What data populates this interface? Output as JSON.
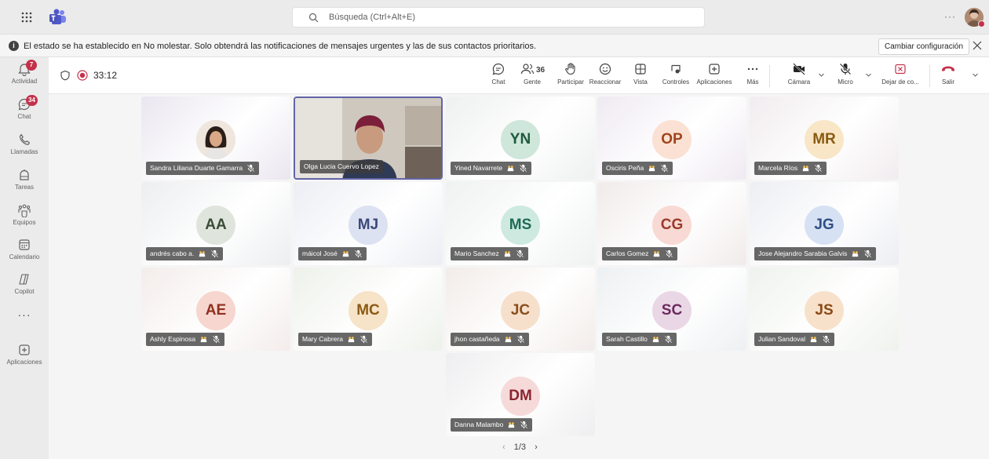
{
  "app": {
    "search_placeholder": "Búsqueda (Ctrl+Alt+E)",
    "more_label": "···"
  },
  "banner": {
    "info_glyph": "i",
    "text": "El estado se ha establecido en No molestar. Solo obtendrá las notificaciones de mensajes urgentes y las de sus contactos prioritarios.",
    "button": "Cambiar configuración"
  },
  "rail": {
    "items": [
      {
        "label": "Actividad",
        "badge": "7",
        "icon": "bell-icon"
      },
      {
        "label": "Chat",
        "badge": "34",
        "icon": "chat-icon"
      },
      {
        "label": "Llamadas",
        "icon": "phone-icon"
      },
      {
        "label": "Tareas",
        "icon": "tasks-icon"
      },
      {
        "label": "Equipos",
        "icon": "teams-icon"
      },
      {
        "label": "Calendario",
        "icon": "calendar-icon"
      },
      {
        "label": "Copilot",
        "icon": "copilot-icon"
      },
      {
        "label": "···",
        "icon": "more-icon"
      },
      {
        "label": "Aplicaciones",
        "icon": "apps-icon"
      }
    ]
  },
  "meeting": {
    "timer": "33:12",
    "people_count": "36",
    "toolbar": [
      {
        "label": "Chat",
        "icon": "chat-icon"
      },
      {
        "label": "Gente",
        "icon": "people-icon"
      },
      {
        "label": "Participar",
        "icon": "raise-hand-icon"
      },
      {
        "label": "Reaccionar",
        "icon": "emoji-icon"
      },
      {
        "label": "Vista",
        "icon": "view-grid-icon"
      },
      {
        "label": "Controles",
        "icon": "controls-icon"
      },
      {
        "label": "Aplicaciones",
        "icon": "apps-add-icon"
      },
      {
        "label": "Más",
        "icon": "more-icon"
      },
      {
        "label": "Cámara",
        "icon": "camera-off-icon"
      },
      {
        "label": "Micro",
        "icon": "mic-off-icon"
      },
      {
        "label": "Dejar de co...",
        "icon": "stop-share-icon"
      },
      {
        "label": "Salir",
        "icon": "hang-up-icon"
      }
    ]
  },
  "participants": [
    {
      "name": "Sandra Liliana Duarte Gamarra",
      "initials": "",
      "photo": true,
      "hand": false,
      "colors": {
        "bg": "#eae6f0",
        "av": "#d9cfc6",
        "fg": "#5a4a3a"
      }
    },
    {
      "name": "Olga Lucia Cuervo Lopez",
      "initials": "",
      "video": true,
      "hand": false,
      "colors": {
        "bg": "#c9c1b8",
        "av": "#d9cfc6",
        "fg": "#5a4a3a"
      }
    },
    {
      "name": "Yined Navarrete",
      "initials": "YN",
      "hand": true,
      "colors": {
        "bg": "#eef1ef",
        "av": "#cfe6da",
        "fg": "#1e5a3b"
      }
    },
    {
      "name": "Osciris Peña",
      "initials": "OP",
      "hand": true,
      "colors": {
        "bg": "#efeaf2",
        "av": "#fbe1d3",
        "fg": "#a0451a"
      }
    },
    {
      "name": "Marcela Ríos",
      "initials": "MR",
      "hand": true,
      "colors": {
        "bg": "#f1ecef",
        "av": "#f8e6c6",
        "fg": "#8a5a10"
      }
    },
    {
      "name": "andrés cabo a.",
      "initials": "AA",
      "hand": true,
      "colors": {
        "bg": "#eceef0",
        "av": "#dfe5dc",
        "fg": "#3a4a36"
      }
    },
    {
      "name": "máicol José",
      "initials": "MJ",
      "hand": true,
      "colors": {
        "bg": "#eceef4",
        "av": "#dde2f2",
        "fg": "#3b4a7a"
      }
    },
    {
      "name": "Mario Sanchez",
      "initials": "MS",
      "hand": true,
      "colors": {
        "bg": "#eef2f1",
        "av": "#cde9e0",
        "fg": "#1f6b55"
      }
    },
    {
      "name": "Carlos Gomez",
      "initials": "CG",
      "hand": true,
      "colors": {
        "bg": "#f1ebeb",
        "av": "#f8d9d3",
        "fg": "#9a3a2a"
      }
    },
    {
      "name": "Jose Alejandro Sarabia Galvis",
      "initials": "JG",
      "hand": true,
      "colors": {
        "bg": "#edeef3",
        "av": "#d6e1f3",
        "fg": "#2f4f86"
      }
    },
    {
      "name": "Ashly Espinosa",
      "initials": "AE",
      "hand": true,
      "colors": {
        "bg": "#f3ecea",
        "av": "#f6d6ce",
        "fg": "#8f2f1f"
      }
    },
    {
      "name": "Mary Cabrera",
      "initials": "MC",
      "hand": true,
      "colors": {
        "bg": "#eef1ea",
        "av": "#f6e3c8",
        "fg": "#8a5a14"
      }
    },
    {
      "name": "jhon castañeda",
      "initials": "JC",
      "hand": true,
      "colors": {
        "bg": "#f2ece9",
        "av": "#f6e0cc",
        "fg": "#8a4f1c"
      }
    },
    {
      "name": "Sarah Castillo",
      "initials": "SC",
      "hand": true,
      "colors": {
        "bg": "#edf0f2",
        "av": "#ead7e6",
        "fg": "#6b2a5e"
      }
    },
    {
      "name": "Julian Sandoval",
      "initials": "JS",
      "hand": true,
      "colors": {
        "bg": "#eef2ec",
        "av": "#f8e1cb",
        "fg": "#8a4a14"
      }
    },
    {
      "name": "Danna Malambo",
      "initials": "DM",
      "hand": true,
      "colors": {
        "bg": "#eeeef0",
        "av": "#f6dada",
        "fg": "#8a2530"
      }
    }
  ],
  "pager": {
    "prev": "‹",
    "text": "1/3",
    "next": "›"
  }
}
